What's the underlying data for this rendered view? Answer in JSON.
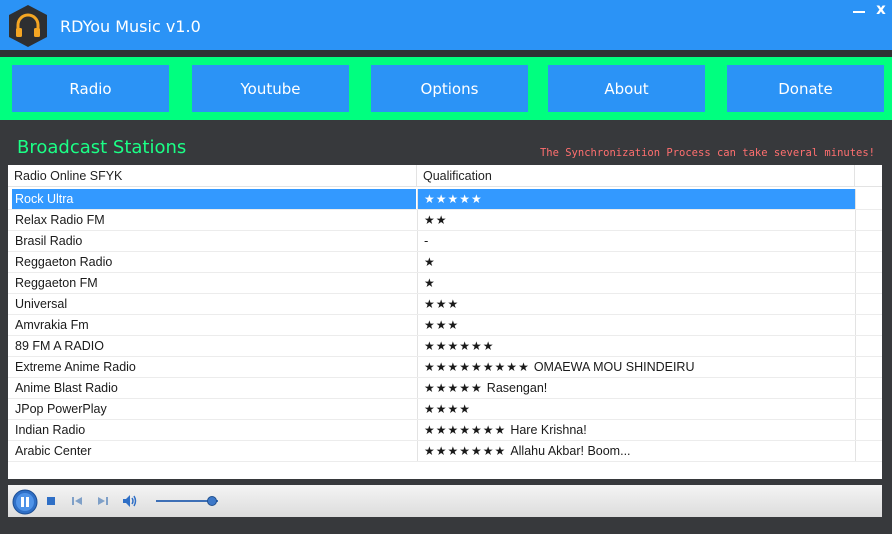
{
  "window": {
    "title": "RDYou Music v1.0",
    "minimize_icon": "minimize-icon",
    "close_label": "x"
  },
  "nav": {
    "buttons": [
      "Radio",
      "Youtube",
      "Options",
      "About",
      "Donate"
    ]
  },
  "section": {
    "title": "Broadcast Stations",
    "sync_note": "The Synchronization Process can take several minutes!"
  },
  "list": {
    "columns": [
      "Radio Online SFYK",
      "Qualification"
    ],
    "selected_index": 0,
    "rows": [
      {
        "name": "Rock Ultra",
        "stars": "★★★★★",
        "note": ""
      },
      {
        "name": "Relax Radio FM",
        "stars": "★★",
        "note": ""
      },
      {
        "name": "Brasil Radio",
        "stars": "-",
        "note": ""
      },
      {
        "name": "Reggaeton Radio",
        "stars": "★",
        "note": ""
      },
      {
        "name": "Reggaeton FM",
        "stars": "★",
        "note": ""
      },
      {
        "name": "Universal",
        "stars": "★★★",
        "note": ""
      },
      {
        "name": "Amvrakia Fm",
        "stars": "★★★",
        "note": ""
      },
      {
        "name": "89 FM A RADIO",
        "stars": "★★★★★★",
        "note": ""
      },
      {
        "name": "Extreme Anime Radio",
        "stars": "★★★★★★★★★",
        "note": "OMAEWA MOU SHINDEIRU"
      },
      {
        "name": "Anime Blast Radio",
        "stars": "★★★★★",
        "note": "Rasengan!"
      },
      {
        "name": "JPop PowerPlay",
        "stars": "★★★★",
        "note": ""
      },
      {
        "name": "Indian Radio",
        "stars": "★★★★★★★",
        "note": "Hare Krishna!"
      },
      {
        "name": "Arabic Center",
        "stars": "★★★★★★★",
        "note": "Allahu Akbar! Boom..."
      }
    ]
  },
  "player": {
    "icons": [
      "pause-icon",
      "stop-icon",
      "previous-icon",
      "next-icon",
      "volume-icon"
    ],
    "volume_fraction": 0.9
  },
  "colors": {
    "titlebar": "#2b93f6",
    "nav_bg": "#00ff7f",
    "nav_button": "#2b93f6",
    "section_title": "#1bff86",
    "sync_note": "#ff6f6f",
    "selection": "#3399ff"
  }
}
